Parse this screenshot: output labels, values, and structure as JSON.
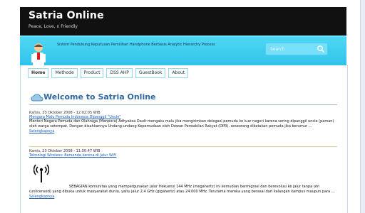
{
  "header": {
    "title": "Satria Online",
    "tagline": "Peace, Love, n Friendly"
  },
  "banner": {
    "text": "Sistem Pendukung Keputusan Pemilihan Handphone Berbasis Analytic Hierarchy Process",
    "search_placeholder": "Search"
  },
  "nav": {
    "items": [
      {
        "label": "Home"
      },
      {
        "label": "Methode"
      },
      {
        "label": "Product"
      },
      {
        "label": "DSS AHP"
      },
      {
        "label": "GuestBook"
      },
      {
        "label": "About"
      }
    ]
  },
  "main": {
    "welcome": "Welcome to Satria Online"
  },
  "posts": [
    {
      "date": "Kamis, 23 Oktober 2008 - 12:02:05 WIB",
      "title": "Mengora Malu Pemuda Indonesia Dipanggil \"Uncle\"",
      "body": "Menteri Negara Pemuda dan Olahraga (Menpora) Adhyaksa Dault mengaku malu jika mengirimkan delegasi pemuda ke luar negeri karena sering dipanggil uncle (paman) oleh warga setempat. Dengan disahkannya Undang-undang Kepemudaan oleh Dewan Perwakilan Rakyat (DPR), seseorang dikatakan pemuda jika berumur ...",
      "more": "Selengkapnya"
    },
    {
      "date": "Kamis, 23 Oktober 2008 - 11:56:47 WIB",
      "title": "Teknologi Wireless: Bersenda karena di Jalur WiFi",
      "body": "SEBAGIAN komunitas yang mempergunakan jalur frekuensi 144 MHz (megahertz) ini kemudian bermigrasi dan berevolusi ke jalur tanpa izin (unlicensed) yang dibuka untuk masyarakat dunia, yaitu jalur 2,4 GHz (gigahertz) atau 24.000 MHz. Terutama mereka yang berasal dari kalangan kampus maupun para ...",
      "more": "Selengkapnya"
    }
  ]
}
